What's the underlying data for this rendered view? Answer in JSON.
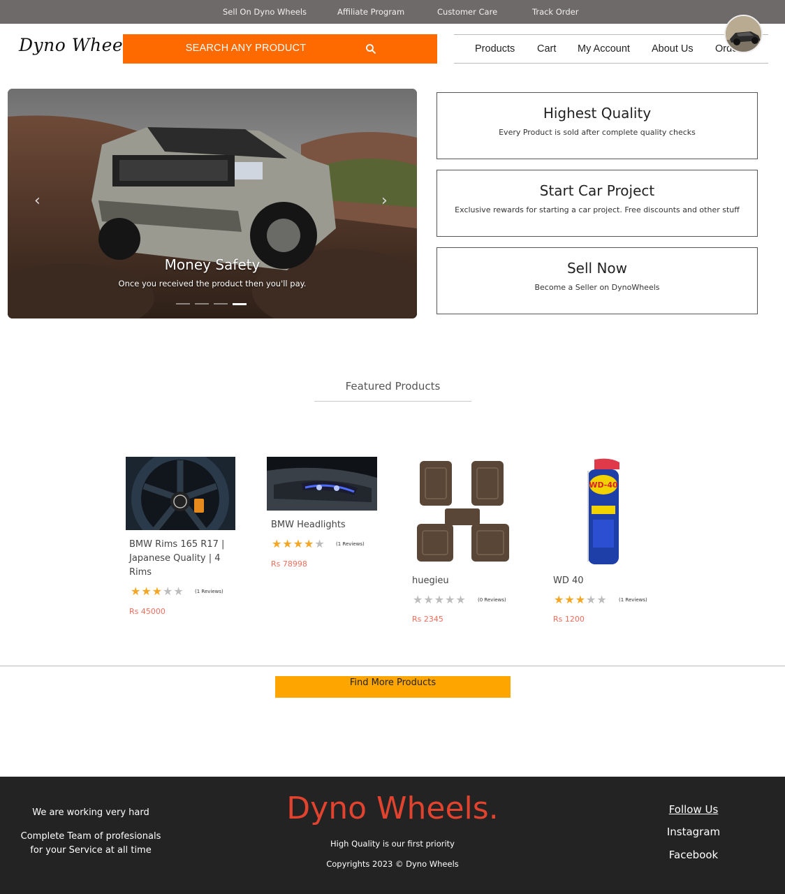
{
  "topbar": {
    "links": [
      "Sell On Dyno Wheels",
      "Affiliate Program",
      "Customer Care",
      "Track Order"
    ]
  },
  "header": {
    "logo": "Dyno Wheels",
    "search_label": "SEARCH ANY PRODUCT",
    "nav": [
      "Products",
      "Cart",
      "My Account",
      "About Us",
      "Orders"
    ]
  },
  "hero": {
    "caption_title": "Money Safety",
    "caption_text": "Once you received the product then you'll pay.",
    "prev_icon": "‹",
    "next_icon": "›",
    "slides": 4,
    "active_slide": 4
  },
  "features": [
    {
      "title": "Highest Quality",
      "subtitle": "Every Product is sold after complete quality checks"
    },
    {
      "title": "Start Car Project",
      "subtitle": "Exclusive rewards for starting a car project. Free discounts and other stuff"
    },
    {
      "title": "Sell Now",
      "subtitle": "Become a Seller on DynoWheels"
    }
  ],
  "featured": {
    "title": "Featured Products",
    "products": [
      {
        "name": "BMW Rims 165 R17 | Japanese Quality | 4 Rims",
        "rating": 3,
        "reviews": "(1 Reviews)",
        "price": "Rs 45000"
      },
      {
        "name": "BMW Headlights",
        "rating": 4,
        "reviews": "(1 Reviews)",
        "price": "Rs 78998"
      },
      {
        "name": "huegieu",
        "rating": 0,
        "reviews": "(0 Reviews)",
        "price": "Rs 2345"
      },
      {
        "name": "WD 40",
        "rating": 3,
        "reviews": "(1 Reviews)",
        "price": "Rs 1200"
      }
    ],
    "more_button": "Find More Products"
  },
  "footer": {
    "line1": "We are working very hard",
    "line2a": "Complete Team of profesionals",
    "line2b": "for your Service at all time",
    "brand": "Dyno Wheels.",
    "tagline": "High Quality is our first priority",
    "copyright": "Copyrights 2023 © Dyno Wheels",
    "follow": "Follow Us",
    "social": [
      "Instagram",
      "Facebook"
    ]
  },
  "colors": {
    "search_bg": "#ff6a00",
    "button_bg": "#ffa500",
    "price": "#f06c5b",
    "star_on": "#f5a623",
    "star_off": "#bdbdbd",
    "footer_bg": "#232323",
    "brand": "#e2432f",
    "topbar_bg": "#6e6a69"
  },
  "icons": {
    "search": "search-icon",
    "star": "star-icon",
    "prev": "chevron-left-icon",
    "next": "chevron-right-icon"
  }
}
